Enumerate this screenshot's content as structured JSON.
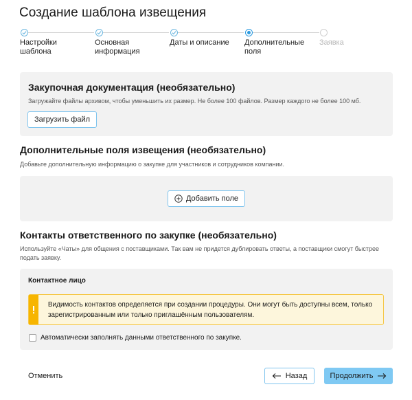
{
  "page": {
    "title": "Создание шаблона извещения"
  },
  "stepper": {
    "steps": [
      {
        "label": "Настройки шаблона",
        "state": "done"
      },
      {
        "label": "Основная информация",
        "state": "done"
      },
      {
        "label": "Даты и описание",
        "state": "done"
      },
      {
        "label": "Дополнительные поля",
        "state": "current"
      },
      {
        "label": "Заявка",
        "state": "future"
      }
    ]
  },
  "docs": {
    "title": "Закупочная документация (необязательно)",
    "hint": "Загружайте файлы архивом, чтобы уменьшить их размер. Не более 100 файлов. Размер каждого не более 100 мб.",
    "upload_label": "Загрузить файл"
  },
  "fields": {
    "title": "Дополнительные поля извещения (необязательно)",
    "hint": "Добавьте дополнительную информацию о закупке для участников и сотрудников компании.",
    "add_label": "Добавить поле"
  },
  "contacts": {
    "title": "Контакты ответственного по закупке (необязательно)",
    "hint": "Используйте «Чаты» для общения с поставщиками. Так вам не придется дублировать ответы, а поставщики смогут быстрее подать заявку.",
    "person_title": "Контактное лицо",
    "warning": "Видимость контактов определяется при создании процедуры. Они могут быть доступны всем, только зарегистрированным или только приглашённым пользователям.",
    "autofill_label": "Автоматически заполнять данными ответственного по закупке.",
    "autofill_checked": false
  },
  "footer": {
    "cancel_label": "Отменить",
    "back_label": "Назад",
    "continue_label": "Продолжить"
  },
  "colors": {
    "accent": "#7fc9f3",
    "panel_bg": "#f2f2f2",
    "warning_stripe": "#f7b500",
    "warning_bg": "#fdf6dc"
  }
}
